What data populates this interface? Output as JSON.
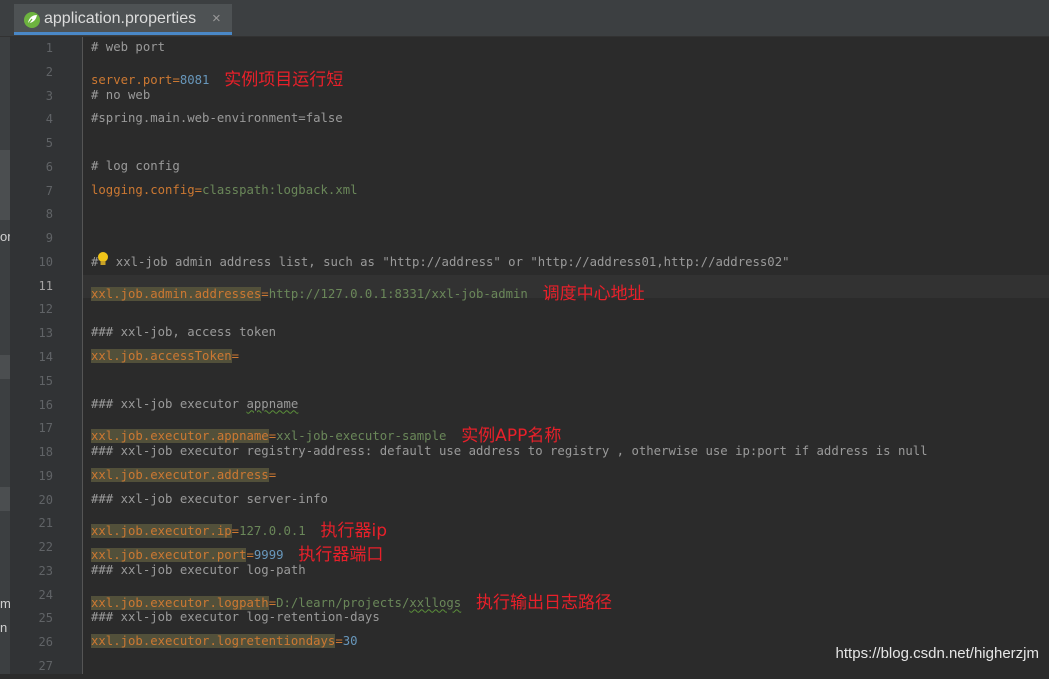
{
  "tab": {
    "title": "application.properties",
    "close": "×",
    "icon": "spring-leaf-icon"
  },
  "left_strip": {
    "cut_labels": [
      "or",
      "m",
      "n"
    ]
  },
  "lines": [
    {
      "num": "1",
      "type": "comment",
      "text": "# web port"
    },
    {
      "num": "2",
      "type": "prop",
      "key": "server.port",
      "eq": "=",
      "value": "8081",
      "value_type": "number",
      "annotation": "实例项目运行短"
    },
    {
      "num": "3",
      "type": "comment",
      "text": "# no web"
    },
    {
      "num": "4",
      "type": "comment",
      "text": "#spring.main.web-environment=false"
    },
    {
      "num": "5",
      "type": "blank"
    },
    {
      "num": "6",
      "type": "comment",
      "text": "# log config"
    },
    {
      "num": "7",
      "type": "prop",
      "key": "logging.config",
      "eq": "=",
      "value": "classpath:logback.xml",
      "value_type": "string"
    },
    {
      "num": "8",
      "type": "blank"
    },
    {
      "num": "9",
      "type": "blank"
    },
    {
      "num": "10",
      "type": "comment_bulb",
      "prefix": "#",
      "text": " xxl-job admin address list, such as \"http://address\" or \"http://address01,http://address02\""
    },
    {
      "num": "11",
      "type": "prop",
      "key": "xxl.job.admin.addresses",
      "eq": "=",
      "value": "http://127.0.0.1:8331/xxl-job-admin",
      "value_type": "string",
      "annotation": "调度中心地址",
      "current": true
    },
    {
      "num": "12",
      "type": "blank"
    },
    {
      "num": "13",
      "type": "comment",
      "text": "### xxl-job, access token"
    },
    {
      "num": "14",
      "type": "prop",
      "key": "xxl.job.accessToken",
      "eq": "=",
      "value": "",
      "value_type": "string"
    },
    {
      "num": "15",
      "type": "blank"
    },
    {
      "num": "16",
      "type": "comment_squig",
      "text": "### xxl-job executor ",
      "squig": "appname"
    },
    {
      "num": "17",
      "type": "prop",
      "key": "xxl.job.executor.appname",
      "eq": "=",
      "value": "xxl-job-executor-sample",
      "value_type": "string",
      "annotation": "实例APP名称"
    },
    {
      "num": "18",
      "type": "comment",
      "text": "### xxl-job executor registry-address: default use address to registry , otherwise use ip:port if address is null"
    },
    {
      "num": "19",
      "type": "prop",
      "key": "xxl.job.executor.address",
      "eq": "=",
      "value": "",
      "value_type": "string"
    },
    {
      "num": "20",
      "type": "comment",
      "text": "### xxl-job executor server-info"
    },
    {
      "num": "21",
      "type": "prop",
      "key": "xxl.job.executor.ip",
      "eq": "=",
      "value": "127.0.0.1",
      "value_type": "string",
      "annotation": "执行器ip"
    },
    {
      "num": "22",
      "type": "prop",
      "key": "xxl.job.executor.port",
      "eq": "=",
      "value": "9999",
      "value_type": "number",
      "annotation": "执行器端口"
    },
    {
      "num": "23",
      "type": "comment",
      "text": "### xxl-job executor log-path"
    },
    {
      "num": "24",
      "type": "prop_squig",
      "key": "xxl.job.executor.logpath",
      "eq": "=",
      "value": "D:/learn/projects/",
      "squig": "xxllogs",
      "value_type": "string",
      "annotation": "执行输出日志路径"
    },
    {
      "num": "25",
      "type": "comment",
      "text": "### xxl-job executor log-retention-days"
    },
    {
      "num": "26",
      "type": "prop",
      "key": "xxl.job.executor.logretentiondays",
      "eq": "=",
      "value": "30",
      "value_type": "number"
    },
    {
      "num": "27",
      "type": "blank"
    }
  ],
  "highlighted_key_lines": [
    "11",
    "14",
    "17",
    "19",
    "21",
    "22",
    "24",
    "26"
  ],
  "watermark": "https://blog.csdn.net/higherzjm",
  "colors": {
    "background": "#2b2b2b",
    "comment": "#9a9a9a",
    "key": "#cc7832",
    "string": "#6a8759",
    "number": "#6897bb",
    "annotation": "#e8202a"
  }
}
